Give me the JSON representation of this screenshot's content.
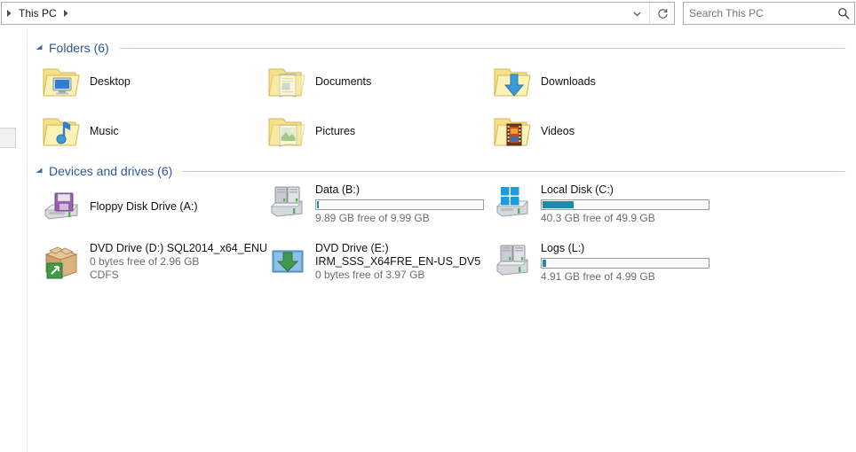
{
  "window": {
    "address": {
      "breadcrumb": "This PC",
      "leading_arrow_icon": "chevron-right-icon",
      "trailing_arrow_icon": "chevron-right-icon",
      "dropdown_icon": "chevron-down-icon",
      "refresh_icon": "refresh-icon"
    },
    "search": {
      "placeholder": "Search This PC",
      "value": "",
      "icon": "search-icon"
    }
  },
  "colors": {
    "group_heading": "#2b579a",
    "capacity_fill": "#1b8ca9",
    "capacity_track": "#fbfbfb",
    "subtext": "#6d6d6d"
  },
  "groups": [
    {
      "id": "folders",
      "title": "Folders (6)",
      "caret_icon": "caret-collapse-icon",
      "items": [
        {
          "name": "Desktop",
          "icon": "folder-desktop-icon"
        },
        {
          "name": "Documents",
          "icon": "folder-documents-icon"
        },
        {
          "name": "Downloads",
          "icon": "folder-downloads-icon"
        },
        {
          "name": "Music",
          "icon": "folder-music-icon"
        },
        {
          "name": "Pictures",
          "icon": "folder-pictures-icon"
        },
        {
          "name": "Videos",
          "icon": "folder-videos-icon"
        }
      ]
    },
    {
      "id": "devices",
      "title": "Devices and drives (6)",
      "caret_icon": "caret-collapse-icon",
      "items": [
        {
          "name": "Floppy Disk Drive (A:)",
          "icon": "floppy-drive-icon",
          "label2": "",
          "free_text": "",
          "filesystem": "",
          "has_bar": false,
          "fill_percent": 0
        },
        {
          "name": "Data (B:)",
          "icon": "hard-drive-icon",
          "label2": "",
          "free_text": "9.89 GB free of 9.99 GB",
          "filesystem": "",
          "has_bar": true,
          "fill_percent": 1
        },
        {
          "name": "Local Disk (C:)",
          "icon": "windows-drive-icon",
          "label2": "",
          "free_text": "40.3 GB free of 49.9 GB",
          "filesystem": "",
          "has_bar": true,
          "fill_percent": 19
        },
        {
          "name": "DVD Drive (D:) SQL2014_x64_ENU",
          "icon": "cd-box-drive-icon",
          "label2": "",
          "free_text": "0 bytes free of 2.96 GB",
          "filesystem": "CDFS",
          "has_bar": false,
          "fill_percent": 0
        },
        {
          "name": "DVD Drive (E:)",
          "icon": "cd-install-drive-icon",
          "label2": "IRM_SSS_X64FRE_EN-US_DV5",
          "free_text": "0 bytes free of 3.97 GB",
          "filesystem": "",
          "has_bar": false,
          "fill_percent": 0
        },
        {
          "name": "Logs (L:)",
          "icon": "hard-drive-icon",
          "label2": "",
          "free_text": "4.91 GB free of 4.99 GB",
          "filesystem": "",
          "has_bar": true,
          "fill_percent": 2
        }
      ]
    }
  ]
}
